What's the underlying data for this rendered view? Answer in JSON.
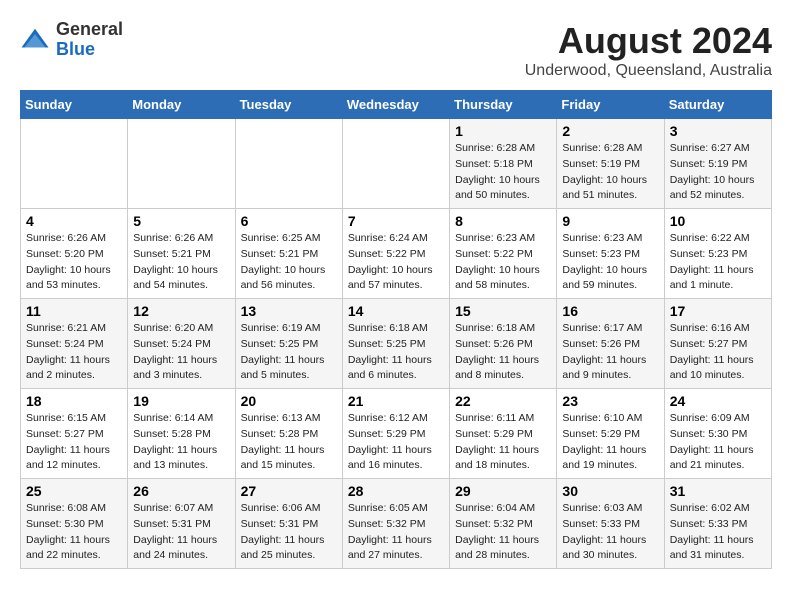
{
  "header": {
    "logo_line1": "General",
    "logo_line2": "Blue",
    "month_year": "August 2024",
    "location": "Underwood, Queensland, Australia"
  },
  "weekdays": [
    "Sunday",
    "Monday",
    "Tuesday",
    "Wednesday",
    "Thursday",
    "Friday",
    "Saturday"
  ],
  "weeks": [
    [
      {
        "day": "",
        "sunrise": "",
        "sunset": "",
        "daylight": ""
      },
      {
        "day": "",
        "sunrise": "",
        "sunset": "",
        "daylight": ""
      },
      {
        "day": "",
        "sunrise": "",
        "sunset": "",
        "daylight": ""
      },
      {
        "day": "",
        "sunrise": "",
        "sunset": "",
        "daylight": ""
      },
      {
        "day": "1",
        "sunrise": "Sunrise: 6:28 AM",
        "sunset": "Sunset: 5:18 PM",
        "daylight": "Daylight: 10 hours and 50 minutes."
      },
      {
        "day": "2",
        "sunrise": "Sunrise: 6:28 AM",
        "sunset": "Sunset: 5:19 PM",
        "daylight": "Daylight: 10 hours and 51 minutes."
      },
      {
        "day": "3",
        "sunrise": "Sunrise: 6:27 AM",
        "sunset": "Sunset: 5:19 PM",
        "daylight": "Daylight: 10 hours and 52 minutes."
      }
    ],
    [
      {
        "day": "4",
        "sunrise": "Sunrise: 6:26 AM",
        "sunset": "Sunset: 5:20 PM",
        "daylight": "Daylight: 10 hours and 53 minutes."
      },
      {
        "day": "5",
        "sunrise": "Sunrise: 6:26 AM",
        "sunset": "Sunset: 5:21 PM",
        "daylight": "Daylight: 10 hours and 54 minutes."
      },
      {
        "day": "6",
        "sunrise": "Sunrise: 6:25 AM",
        "sunset": "Sunset: 5:21 PM",
        "daylight": "Daylight: 10 hours and 56 minutes."
      },
      {
        "day": "7",
        "sunrise": "Sunrise: 6:24 AM",
        "sunset": "Sunset: 5:22 PM",
        "daylight": "Daylight: 10 hours and 57 minutes."
      },
      {
        "day": "8",
        "sunrise": "Sunrise: 6:23 AM",
        "sunset": "Sunset: 5:22 PM",
        "daylight": "Daylight: 10 hours and 58 minutes."
      },
      {
        "day": "9",
        "sunrise": "Sunrise: 6:23 AM",
        "sunset": "Sunset: 5:23 PM",
        "daylight": "Daylight: 10 hours and 59 minutes."
      },
      {
        "day": "10",
        "sunrise": "Sunrise: 6:22 AM",
        "sunset": "Sunset: 5:23 PM",
        "daylight": "Daylight: 11 hours and 1 minute."
      }
    ],
    [
      {
        "day": "11",
        "sunrise": "Sunrise: 6:21 AM",
        "sunset": "Sunset: 5:24 PM",
        "daylight": "Daylight: 11 hours and 2 minutes."
      },
      {
        "day": "12",
        "sunrise": "Sunrise: 6:20 AM",
        "sunset": "Sunset: 5:24 PM",
        "daylight": "Daylight: 11 hours and 3 minutes."
      },
      {
        "day": "13",
        "sunrise": "Sunrise: 6:19 AM",
        "sunset": "Sunset: 5:25 PM",
        "daylight": "Daylight: 11 hours and 5 minutes."
      },
      {
        "day": "14",
        "sunrise": "Sunrise: 6:18 AM",
        "sunset": "Sunset: 5:25 PM",
        "daylight": "Daylight: 11 hours and 6 minutes."
      },
      {
        "day": "15",
        "sunrise": "Sunrise: 6:18 AM",
        "sunset": "Sunset: 5:26 PM",
        "daylight": "Daylight: 11 hours and 8 minutes."
      },
      {
        "day": "16",
        "sunrise": "Sunrise: 6:17 AM",
        "sunset": "Sunset: 5:26 PM",
        "daylight": "Daylight: 11 hours and 9 minutes."
      },
      {
        "day": "17",
        "sunrise": "Sunrise: 6:16 AM",
        "sunset": "Sunset: 5:27 PM",
        "daylight": "Daylight: 11 hours and 10 minutes."
      }
    ],
    [
      {
        "day": "18",
        "sunrise": "Sunrise: 6:15 AM",
        "sunset": "Sunset: 5:27 PM",
        "daylight": "Daylight: 11 hours and 12 minutes."
      },
      {
        "day": "19",
        "sunrise": "Sunrise: 6:14 AM",
        "sunset": "Sunset: 5:28 PM",
        "daylight": "Daylight: 11 hours and 13 minutes."
      },
      {
        "day": "20",
        "sunrise": "Sunrise: 6:13 AM",
        "sunset": "Sunset: 5:28 PM",
        "daylight": "Daylight: 11 hours and 15 minutes."
      },
      {
        "day": "21",
        "sunrise": "Sunrise: 6:12 AM",
        "sunset": "Sunset: 5:29 PM",
        "daylight": "Daylight: 11 hours and 16 minutes."
      },
      {
        "day": "22",
        "sunrise": "Sunrise: 6:11 AM",
        "sunset": "Sunset: 5:29 PM",
        "daylight": "Daylight: 11 hours and 18 minutes."
      },
      {
        "day": "23",
        "sunrise": "Sunrise: 6:10 AM",
        "sunset": "Sunset: 5:29 PM",
        "daylight": "Daylight: 11 hours and 19 minutes."
      },
      {
        "day": "24",
        "sunrise": "Sunrise: 6:09 AM",
        "sunset": "Sunset: 5:30 PM",
        "daylight": "Daylight: 11 hours and 21 minutes."
      }
    ],
    [
      {
        "day": "25",
        "sunrise": "Sunrise: 6:08 AM",
        "sunset": "Sunset: 5:30 PM",
        "daylight": "Daylight: 11 hours and 22 minutes."
      },
      {
        "day": "26",
        "sunrise": "Sunrise: 6:07 AM",
        "sunset": "Sunset: 5:31 PM",
        "daylight": "Daylight: 11 hours and 24 minutes."
      },
      {
        "day": "27",
        "sunrise": "Sunrise: 6:06 AM",
        "sunset": "Sunset: 5:31 PM",
        "daylight": "Daylight: 11 hours and 25 minutes."
      },
      {
        "day": "28",
        "sunrise": "Sunrise: 6:05 AM",
        "sunset": "Sunset: 5:32 PM",
        "daylight": "Daylight: 11 hours and 27 minutes."
      },
      {
        "day": "29",
        "sunrise": "Sunrise: 6:04 AM",
        "sunset": "Sunset: 5:32 PM",
        "daylight": "Daylight: 11 hours and 28 minutes."
      },
      {
        "day": "30",
        "sunrise": "Sunrise: 6:03 AM",
        "sunset": "Sunset: 5:33 PM",
        "daylight": "Daylight: 11 hours and 30 minutes."
      },
      {
        "day": "31",
        "sunrise": "Sunrise: 6:02 AM",
        "sunset": "Sunset: 5:33 PM",
        "daylight": "Daylight: 11 hours and 31 minutes."
      }
    ]
  ]
}
